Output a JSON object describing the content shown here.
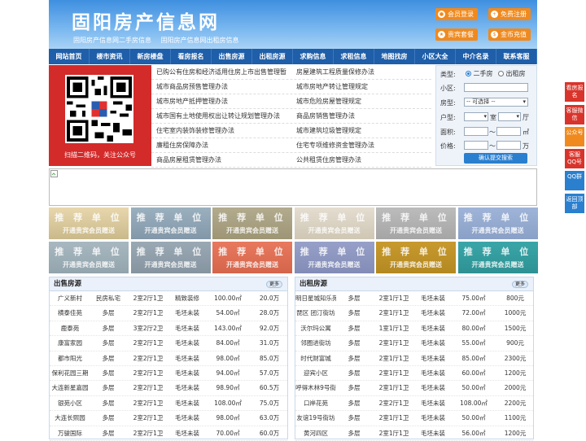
{
  "header": {
    "title": "固阳房产信息网",
    "subtitle": [
      "固阳房产信息网二手房信息",
      "固阳房产信息网出租房信息"
    ],
    "buttons": [
      {
        "label": "会员登录",
        "icon": "user-icon"
      },
      {
        "label": "免费注册",
        "icon": "user-add-icon"
      },
      {
        "label": "贵宾套餐",
        "icon": "vip-icon"
      },
      {
        "label": "金币充值",
        "icon": "coin-icon"
      }
    ]
  },
  "nav": [
    "网站首页",
    "楼市资讯",
    "新房楼盘",
    "看房报名",
    "出售房源",
    "出租房源",
    "求购信息",
    "求租信息",
    "地图找房",
    "小区大全",
    "中介名录",
    "联系客服"
  ],
  "qr": {
    "caption": "扫描二维码，关注公众号"
  },
  "links": [
    [
      "已购公有住房和经济适用住房上市出售管理暂",
      "房屋建筑工程质量保修办法"
    ],
    [
      "城市商品房预售管理办法",
      "城市房地产转让管理规定"
    ],
    [
      "城市房地产抵押管理办法",
      "城市危险房屋管理规定"
    ],
    [
      "城市国有土地使用权出让转让规划管理办法",
      "商品房销售管理办法"
    ],
    [
      "住宅室内装饰装修管理办法",
      "城市建筑垃圾管理规定"
    ],
    [
      "廉租住房保障办法",
      "住宅专项维修资金管理办法"
    ],
    [
      "商品房屋租赁管理办法",
      "公共租赁住房管理办法"
    ]
  ],
  "search": {
    "type_label": "类型:",
    "opt1": "二手房",
    "opt2": "出租房",
    "community_label": "小区:",
    "housetype_label": "房型:",
    "housetype_value": "-- 可选择 --",
    "layout_label": "户型:",
    "room_unit": "室",
    "hall_unit": "厅",
    "area_label": "面积:",
    "area_sep": "～",
    "area_unit": "㎡",
    "price_label": "价格:",
    "price_sep": "～",
    "price_unit": "万",
    "submit": "确认提交搜索"
  },
  "ads": {
    "line1": "推 荐 单 位",
    "line2": "开通贵宾会员赠送"
  },
  "sale": {
    "title": "出售房源",
    "more": "更多",
    "rows": [
      [
        "广义新村",
        "民房私宅",
        "2室2厅1卫",
        "精致装修",
        "100.00㎡",
        "20.0万"
      ],
      [
        "横泰佳苑",
        "多层",
        "2室2厅1卫",
        "毛坯未装",
        "54.00㎡",
        "28.0万"
      ],
      [
        "鹿泰苑",
        "多层",
        "3室2厅2卫",
        "毛坯未装",
        "143.00㎡",
        "92.0万"
      ],
      [
        "康富家园",
        "多层",
        "2室2厅1卫",
        "毛坯未装",
        "84.00㎡",
        "31.0万"
      ],
      [
        "都市阳光",
        "多层",
        "2室2厅1卫",
        "毛坯未装",
        "98.00㎡",
        "85.0万"
      ],
      [
        "保利花园三期",
        "多层",
        "2室2厅1卫",
        "毛坯未装",
        "94.00㎡",
        "57.0万"
      ],
      [
        "大连新星嘉园",
        "多层",
        "2室2厅1卫",
        "毛坯未装",
        "98.90㎡",
        "60.5万"
      ],
      [
        "银苑小区",
        "多层",
        "2室2厅1卫",
        "毛坯未装",
        "108.00㎡",
        "75.0万"
      ],
      [
        "大连长熙园",
        "多层",
        "2室2厅1卫",
        "毛坯未装",
        "98.00㎡",
        "63.0万"
      ],
      [
        "万骏国际",
        "多层",
        "2室2厅1卫",
        "毛坯未装",
        "70.00㎡",
        "60.0万"
      ]
    ]
  },
  "rent": {
    "title": "出租房源",
    "more": "更多",
    "rows": [
      [
        "明日星城知乐苑",
        "多层",
        "2室1厅1卫",
        "毛坯未装",
        "75.00㎡",
        "800元"
      ],
      [
        "琵区 团汀街坊",
        "多层",
        "2室1厅1卫",
        "毛坯未装",
        "72.00㎡",
        "1000元"
      ],
      [
        "沃尔玛公寓",
        "多层",
        "1室1厅1卫",
        "毛坯未装",
        "80.00㎡",
        "1500元"
      ],
      [
        "邻圈进街坊",
        "多层",
        "2室1厅1卫",
        "毛坯未装",
        "55.00㎡",
        "900元"
      ],
      [
        "时代财富城",
        "多层",
        "2室1厅1卫",
        "毛坯未装",
        "85.00㎡",
        "2300元"
      ],
      [
        "迎宾小区",
        "多层",
        "2室1厅1卫",
        "毛坯未装",
        "60.00㎡",
        "1200元"
      ],
      [
        "呼得木林9号街",
        "多层",
        "2室1厅1卫",
        "毛坯未装",
        "50.00㎡",
        "2000元"
      ],
      [
        "口岸花苑",
        "多层",
        "2室2厅1卫",
        "毛坯未装",
        "108.00㎡",
        "2200元"
      ],
      [
        "友谊19号街坊",
        "多层",
        "2室1厅1卫",
        "毛坯未装",
        "50.00㎡",
        "1100元"
      ],
      [
        "黄河四区",
        "多层",
        "2室1厅1卫",
        "毛坯未装",
        "56.00㎡",
        "1200元"
      ]
    ]
  },
  "side": [
    {
      "label": "看房报名",
      "color": "#d9342b"
    },
    {
      "label": "客服微信",
      "color": "#d9342b"
    },
    {
      "label": "公众号",
      "color": "#f08a1e"
    },
    {
      "label": "客服QQ号",
      "color": "#d9342b"
    },
    {
      "label": "QQ群",
      "color": "#2a7fcf"
    },
    {
      "label": "返回顶部",
      "color": "#2a7fcf"
    }
  ]
}
